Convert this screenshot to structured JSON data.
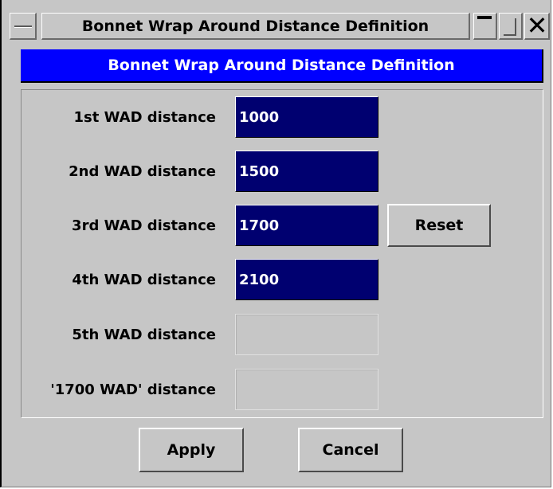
{
  "window": {
    "title": "Bonnet Wrap Around Distance Definition"
  },
  "header": {
    "title": "Bonnet Wrap Around Distance Definition"
  },
  "rows": [
    {
      "label": "1st WAD distance",
      "value": "1000"
    },
    {
      "label": "2nd WAD distance",
      "value": "1500"
    },
    {
      "label": "3rd WAD distance",
      "value": "1700"
    },
    {
      "label": "4th WAD distance",
      "value": "2100"
    },
    {
      "label": "5th WAD distance",
      "value": ""
    },
    {
      "label": "'1700 WAD' distance",
      "value": ""
    }
  ],
  "buttons": {
    "reset": "Reset",
    "apply": "Apply",
    "cancel": "Cancel"
  },
  "colors": {
    "header_bg": "#0000ff",
    "field_bg": "#000070",
    "dialog_bg": "#c6c6c6"
  },
  "icons": {
    "system_menu": "dash-icon",
    "minimize": "minimize-icon",
    "maximize": "maximize-icon",
    "close": "close-icon"
  }
}
